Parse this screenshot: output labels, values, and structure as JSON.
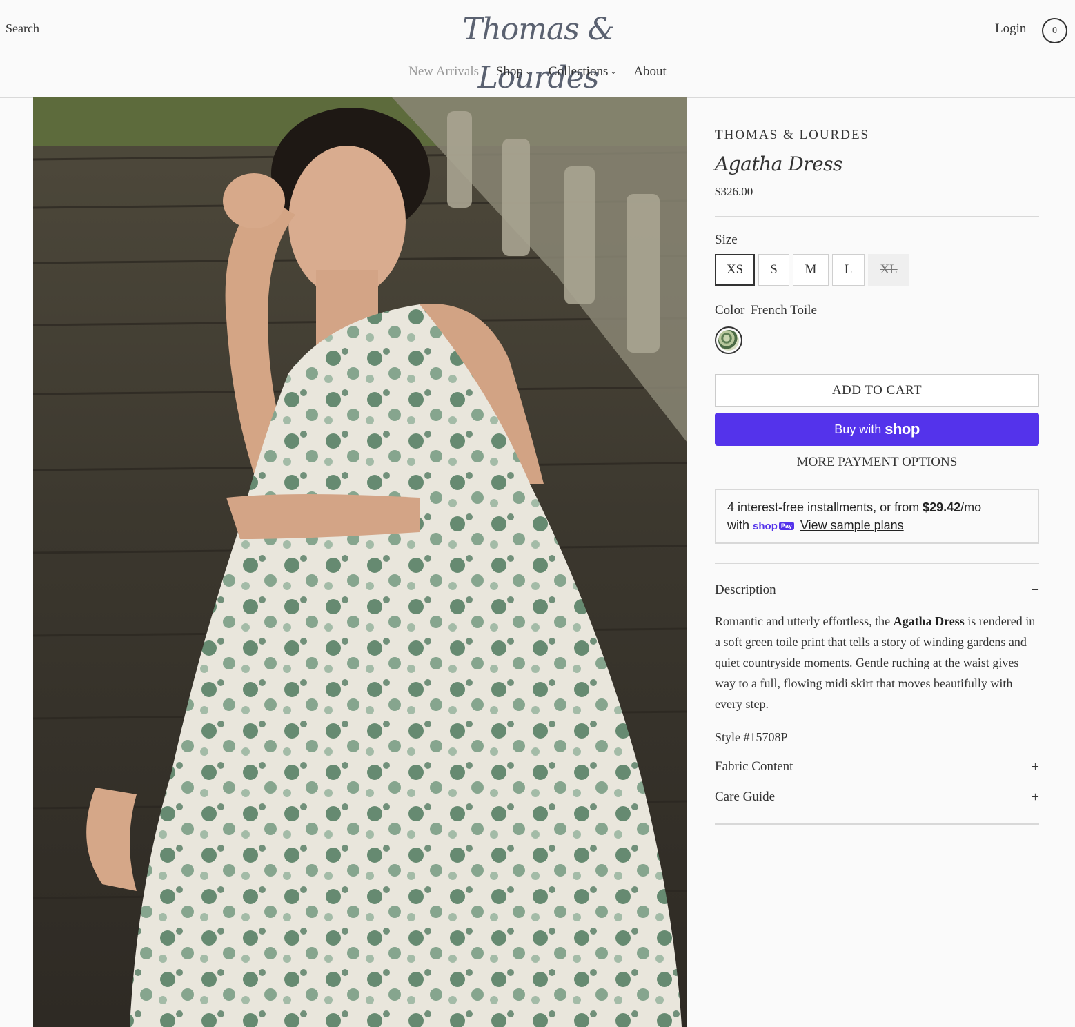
{
  "header": {
    "search_label": "Search",
    "logo_text": "Thomas & Lourdes",
    "login_label": "Login",
    "cart_count": "0"
  },
  "nav": {
    "items": [
      {
        "label": "New Arrivals",
        "has_dropdown": false
      },
      {
        "label": "Shop",
        "has_dropdown": true
      },
      {
        "label": "Collections",
        "has_dropdown": true
      },
      {
        "label": "About",
        "has_dropdown": false
      }
    ]
  },
  "product": {
    "brand": "THOMAS & LOURDES",
    "title": "Agatha Dress",
    "price": "$326.00",
    "size_label": "Size",
    "sizes": [
      {
        "label": "XS",
        "state": "selected"
      },
      {
        "label": "S",
        "state": "available"
      },
      {
        "label": "M",
        "state": "available"
      },
      {
        "label": "L",
        "state": "available"
      },
      {
        "label": "XL",
        "state": "sold-out"
      }
    ],
    "color_label": "Color",
    "color_value": "French Toile",
    "add_to_cart": "ADD TO CART",
    "buy_with": "Buy with",
    "shop_word": "shop",
    "more_payment": "MORE PAYMENT OPTIONS",
    "installments": {
      "text_before": "4 interest-free installments, or from ",
      "amount": "$29.42",
      "text_after": "/mo",
      "with": "with",
      "shop_badge": "shop",
      "pay_badge": "Pay",
      "view_plans": "View sample plans"
    },
    "description_heading": "Description",
    "description_toggle": "−",
    "description_before": "Romantic and utterly effortless, the ",
    "description_bold": "Agatha Dress",
    "description_after": " is rendered in a soft green toile print that tells a story of winding gardens and quiet countryside moments. Gentle ruching at the waist gives way to a full, flowing midi skirt that moves beautifully with every step.",
    "style_number": "Style #15708P",
    "fabric_heading": "Fabric Content",
    "fabric_toggle": "+",
    "care_heading": "Care Guide",
    "care_toggle": "+"
  },
  "colors": {
    "shop_pay_purple": "#5433eb",
    "text": "#333333",
    "rule": "#d8d8d8"
  }
}
